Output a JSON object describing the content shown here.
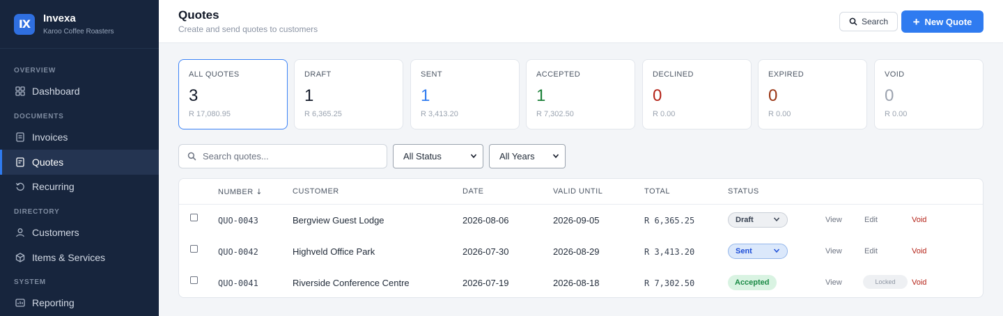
{
  "app": {
    "logo_glyph": "IX",
    "name": "Invexa",
    "org": "Karoo Coffee Roasters",
    "accent": "#2f7bf0",
    "sidebar_bg": "#17253d"
  },
  "sidebar": {
    "sections": [
      {
        "label": "OVERVIEW"
      },
      {
        "label": "DOCUMENTS"
      },
      {
        "label": "DIRECTORY"
      },
      {
        "label": "SYSTEM"
      }
    ],
    "items": [
      {
        "label": "Dashboard",
        "icon": "grid-icon"
      },
      {
        "label": "Invoices",
        "icon": "document-icon"
      },
      {
        "label": "Quotes",
        "icon": "quote-document-icon",
        "active": true
      },
      {
        "label": "Recurring",
        "icon": "refresh-icon"
      },
      {
        "label": "Customers",
        "icon": "user-icon"
      },
      {
        "label": "Items & Services",
        "icon": "box-icon"
      },
      {
        "label": "Reporting",
        "icon": "chart-icon"
      }
    ]
  },
  "header": {
    "title": "Quotes",
    "subtitle": "Create and send quotes to customers",
    "search_label": "Search",
    "new_label": "New Quote"
  },
  "stats": [
    {
      "label": "ALL QUOTES",
      "count": "3",
      "amount": "R 17,080.95",
      "color": "#111827",
      "active": true
    },
    {
      "label": "DRAFT",
      "count": "1",
      "amount": "R 6,365.25",
      "color": "#111827"
    },
    {
      "label": "SENT",
      "count": "1",
      "amount": "R 3,413.20",
      "color": "#2f7bf0"
    },
    {
      "label": "ACCEPTED",
      "count": "1",
      "amount": "R 7,302.50",
      "color": "#1a7f37"
    },
    {
      "label": "DECLINED",
      "count": "0",
      "amount": "R 0.00",
      "color": "#b42318"
    },
    {
      "label": "EXPIRED",
      "count": "0",
      "amount": "R 0.00",
      "color": "#9a3412"
    },
    {
      "label": "VOID",
      "count": "0",
      "amount": "R 0.00",
      "color": "#9ca3af"
    }
  ],
  "filters": {
    "search_placeholder": "Search quotes...",
    "status_value": "All Status",
    "year_value": "All Years"
  },
  "table": {
    "headers": {
      "number": "NUMBER",
      "sort_glyph": "↓",
      "customer": "CUSTOMER",
      "date": "DATE",
      "valid_until": "VALID UNTIL",
      "total": "TOTAL",
      "status": "STATUS"
    },
    "rows": [
      {
        "number": "QUO-0043",
        "customer": "Bergview Guest Lodge",
        "date": "2026-08-06",
        "valid_until": "2026-09-05",
        "total": "R 6,365.25",
        "status": "Draft",
        "view": "View",
        "edit": "Edit",
        "void": "Void"
      },
      {
        "number": "QUO-0042",
        "customer": "Highveld Office Park",
        "date": "2026-07-30",
        "valid_until": "2026-08-29",
        "total": "R 3,413.20",
        "status": "Sent",
        "view": "View",
        "edit": "Edit",
        "void": "Void"
      },
      {
        "number": "QUO-0041",
        "customer": "Riverside Conference Centre",
        "date": "2026-07-19",
        "valid_until": "2026-08-18",
        "total": "R 7,302.50",
        "status": "Accepted",
        "view": "View",
        "locked": "Locked",
        "void": "Void"
      }
    ]
  }
}
